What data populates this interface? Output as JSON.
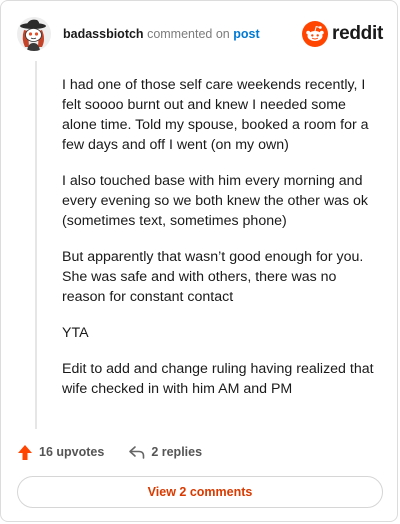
{
  "header": {
    "username": "badassbiotch",
    "action_text": "commented on",
    "target_text": "post",
    "logo_text": "reddit"
  },
  "comment": {
    "paragraphs": [
      "I had one of those self care weekends recently, I felt soooo burnt out and knew I needed some alone time. Told my spouse, booked a room for a few days and off I went (on my own)",
      "I also touched base with him every morning and every evening so we both knew the other was ok (sometimes text, sometimes phone)",
      "But apparently that wasn’t good enough for you. She was safe and with others, there was no reason for constant contact",
      "YTA",
      "Edit to add and change ruling having realized that wife checked in with him AM and PM"
    ]
  },
  "actions": {
    "upvotes": "16 upvotes",
    "replies": "2 replies"
  },
  "footer": {
    "view_comments": "View 2 comments"
  },
  "colors": {
    "brand": "#ff4500",
    "upvote": "#ff4500",
    "link": "#0079d3",
    "button_text": "#d93a00"
  },
  "icons": {
    "avatar": "snoo-avatar",
    "logo": "reddit-logo-icon",
    "upvote": "upvote-arrow-icon",
    "reply": "reply-arrow-icon"
  }
}
